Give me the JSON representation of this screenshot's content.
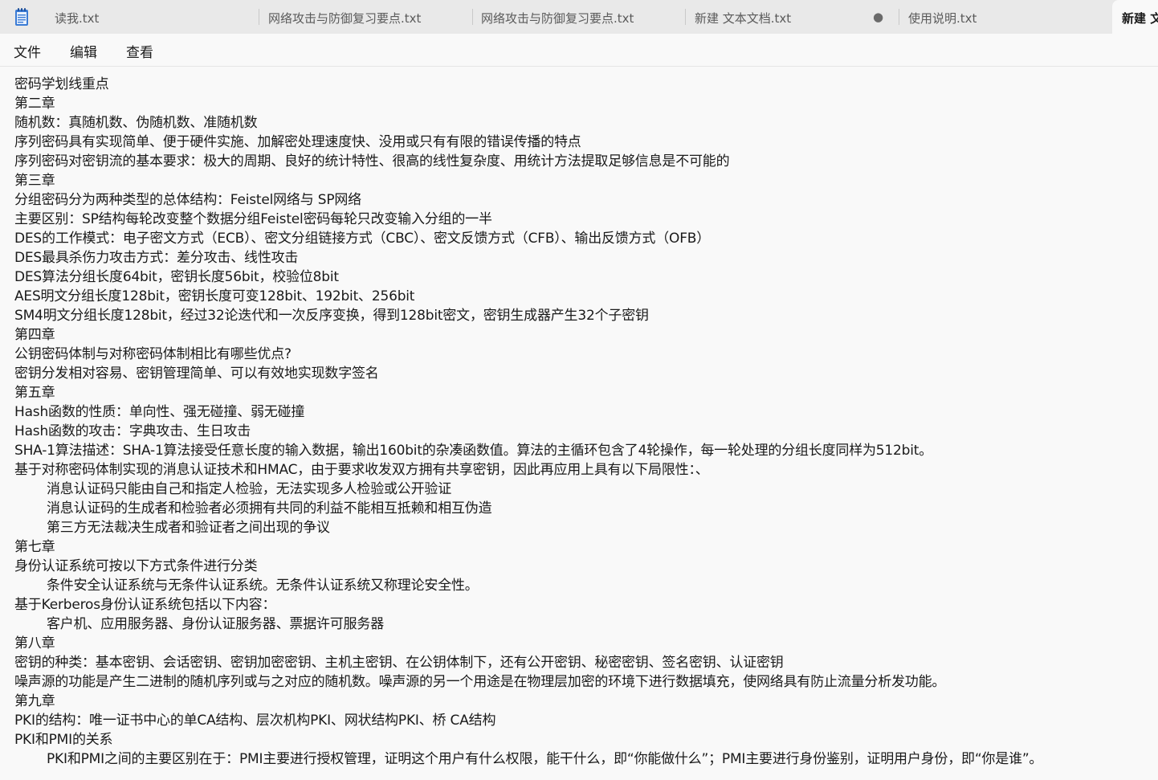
{
  "tabs": [
    {
      "label": "读我.txt"
    },
    {
      "label": "网络攻击与防御复习要点.txt"
    },
    {
      "label": "网络攻击与防御复习要点.txt"
    },
    {
      "label": "新建 文本文档.txt",
      "unsaved_marker": "●"
    },
    {
      "label": "使用说明.txt"
    },
    {
      "label": "新建 文"
    }
  ],
  "menu": {
    "file": "文件",
    "edit": "编辑",
    "view": "查看"
  },
  "icons": {
    "app": "notepad-icon"
  },
  "editor": {
    "lines": [
      "密码学划线重点",
      "第二章",
      "随机数：真随机数、伪随机数、准随机数",
      "序列密码具有实现简单、便于硬件实施、加解密处理速度快、没用或只有有限的错误传播的特点",
      "序列密码对密钥流的基本要求：极大的周期、良好的统计特性、很高的线性复杂度、用统计方法提取足够信息是不可能的",
      "第三章",
      "分组密码分为两种类型的总体结构：Feistel网络与 SP网络",
      "主要区别：SP结构每轮改变整个数据分组Feistel密码每轮只改变输入分组的一半",
      "DES的工作模式：电子密文方式（ECB）、密文分组链接方式（CBC）、密文反馈方式（CFB）、输出反馈方式（OFB）",
      "DES最具杀伤力攻击方式：差分攻击、线性攻击",
      "DES算法分组长度64bit，密钥长度56bit，校验位8bit",
      "AES明文分组长度128bit，密钥长度可变128bit、192bit、256bit",
      "SM4明文分组长度128bit，经过32论迭代和一次反序变换，得到128bit密文，密钥生成器产生32个子密钥",
      "第四章",
      "公钥密码体制与对称密码体制相比有哪些优点?",
      "密钥分发相对容易、密钥管理简单、可以有效地实现数字签名",
      "第五章",
      "Hash函数的性质：单向性、强无碰撞、弱无碰撞",
      "Hash函数的攻击：字典攻击、生日攻击",
      "SHA-1算法描述：SHA-1算法接受任意长度的输入数据，输出160bit的杂凑函数值。算法的主循环包含了4轮操作，每一轮处理的分组长度同样为512bit。",
      "基于对称密码体制实现的消息认证技术和HMAC，由于要求收发双方拥有共享密钥，因此再应用上具有以下局限性：、",
      "消息认证码只能由自己和指定人检验，无法实现多人检验或公开验证",
      "消息认证码的生成者和检验者必须拥有共同的利益不能相互抵赖和相互伪造",
      "第三方无法裁决生成者和验证者之间出现的争议",
      "第七章",
      "身份认证系统可按以下方式条件进行分类",
      "条件安全认证系统与无条件认证系统。无条件认证系统又称理论安全性。",
      "基于Kerberos身份认证系统包括以下内容：",
      "客户机、应用服务器、身份认证服务器、票据许可服务器",
      "第八章",
      "密钥的种类：基本密钥、会话密钥、密钥加密密钥、主机主密钥、在公钥体制下，还有公开密钥、秘密密钥、签名密钥、认证密钥",
      "噪声源的功能是产生二进制的随机序列或与之对应的随机数。噪声源的另一个用途是在物理层加密的环境下进行数据填充，使网络具有防止流量分析发功能。",
      "第九章",
      "PKI的结构：唯一证书中心的单CA结构、层次机构PKI、网状结构PKI、桥 CA结构",
      "PKI和PMI的关系",
      "PKI和PMI之间的主要区别在于：PMI主要进行授权管理，证明这个用户有什么权限，能干什么，即“你能做什么”；PMI主要进行身份鉴别，证明用户身份，即“你是谁”。"
    ]
  }
}
